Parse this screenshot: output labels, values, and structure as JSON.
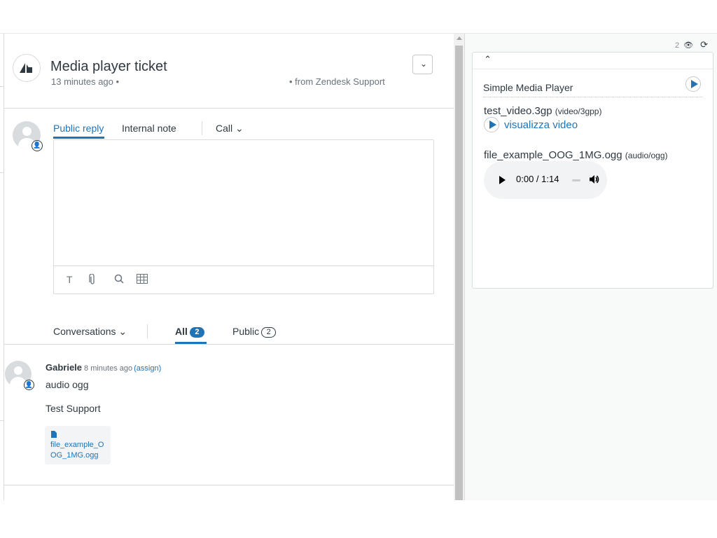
{
  "ticket": {
    "title": "Media player ticket",
    "age": "13 minutes ago •",
    "source": "• from Zendesk Support",
    "menu_icon": "chevron-down-icon"
  },
  "composer": {
    "tabs": [
      {
        "label": "Public reply",
        "active": true
      },
      {
        "label": "Internal note",
        "active": false
      },
      {
        "label": "Call ⌄",
        "active": false
      }
    ],
    "tools": [
      "T",
      "📎",
      "🔍",
      "▦"
    ]
  },
  "conversations": {
    "filter_label": "Conversations ⌄",
    "all_label": "All",
    "all_count": "2",
    "public_label": "Public",
    "public_count": "2"
  },
  "comment": {
    "author": "Gabriele",
    "time": "8 minutes ago",
    "assign": "(assign)",
    "line1": "audio ogg",
    "line2": "Test Support",
    "attachment": "file_example_OOG_1MG.ogg"
  },
  "sidebar": {
    "count": "2",
    "app_title": "Simple Media Player",
    "video_name": "test_video.3gp",
    "video_mime": "(video/3gpp)",
    "video_link": "visualizza video",
    "audio_name": "file_example_OOG_1MG.ogg",
    "audio_mime": "(audio/ogg)",
    "audio_time": "0:00 / 1:14",
    "audio_progress": 0
  },
  "colors": {
    "accent": "#1f73b7",
    "text": "#2f3941",
    "muted": "#68737d",
    "border": "#d8dcde"
  }
}
